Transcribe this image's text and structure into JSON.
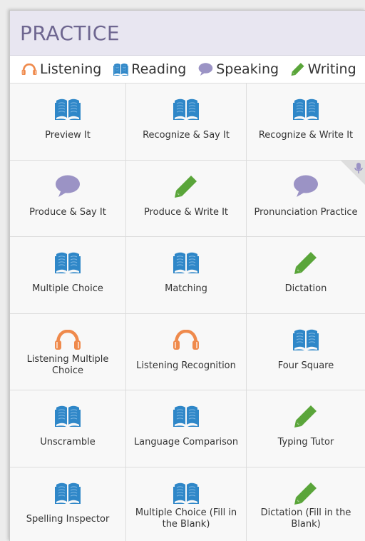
{
  "header": {
    "title": "PRACTICE"
  },
  "legend": [
    {
      "label": "Listening",
      "icon": "headphones-icon"
    },
    {
      "label": "Reading",
      "icon": "book-icon"
    },
    {
      "label": "Speaking",
      "icon": "speech-bubble-icon"
    },
    {
      "label": "Writing",
      "icon": "pencil-icon"
    }
  ],
  "colors": {
    "reading": "#2f87c8",
    "listening": "#ef8a4c",
    "speaking": "#9b93c5",
    "writing": "#5aa53a"
  },
  "tiles": [
    {
      "label": "Preview It",
      "icon": "book-icon"
    },
    {
      "label": "Recognize & Say It",
      "icon": "book-icon"
    },
    {
      "label": "Recognize & Write It",
      "icon": "book-icon"
    },
    {
      "label": "Produce & Say It",
      "icon": "speech-bubble-icon"
    },
    {
      "label": "Produce & Write It",
      "icon": "pencil-icon"
    },
    {
      "label": "Pronunciation Practice",
      "icon": "speech-bubble-icon",
      "badge": "microphone-icon"
    },
    {
      "label": "Multiple Choice",
      "icon": "book-icon"
    },
    {
      "label": "Matching",
      "icon": "book-icon"
    },
    {
      "label": "Dictation",
      "icon": "pencil-icon"
    },
    {
      "label": "Listening Multiple Choice",
      "icon": "headphones-icon"
    },
    {
      "label": "Listening Recognition",
      "icon": "headphones-icon"
    },
    {
      "label": "Four Square",
      "icon": "book-icon"
    },
    {
      "label": "Unscramble",
      "icon": "book-icon"
    },
    {
      "label": "Language Comparison",
      "icon": "book-icon"
    },
    {
      "label": "Typing Tutor",
      "icon": "pencil-icon"
    },
    {
      "label": "Spelling Inspector",
      "icon": "book-icon"
    },
    {
      "label": "Multiple Choice (Fill in the Blank)",
      "icon": "book-icon"
    },
    {
      "label": "Dictation (Fill in the Blank)",
      "icon": "pencil-icon"
    }
  ]
}
